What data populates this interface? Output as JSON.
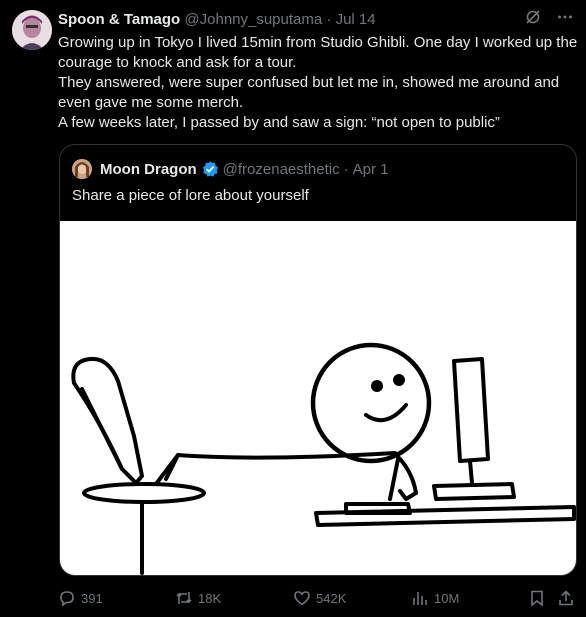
{
  "tweet": {
    "author_name": "Spoon & Tamago",
    "handle": "@Johnny_suputama",
    "separator": "·",
    "date": "Jul 14",
    "body": [
      "Growing up in Tokyo I lived 15min from Studio Ghibli. One day I worked up the courage to knock and ask for a tour.",
      "They answered, were super confused but let me in, showed me around and even gave me some merch.",
      "A few weeks later, I passed by and saw a sign: “not open to public”"
    ],
    "header_icons": [
      "grok-icon",
      "more-icon"
    ]
  },
  "quote": {
    "author_name": "Moon Dragon",
    "handle": "@frozenaesthetic",
    "separator": "·",
    "date": "Apr 1",
    "text": "Share a piece of lore about yourself",
    "media_description_icon": "stick-figure-at-computer-drawing"
  },
  "actions": {
    "replies": "391",
    "reposts": "18K",
    "likes": "542K",
    "views": "10M",
    "icons": [
      "reply-icon",
      "repost-icon",
      "like-icon",
      "views-icon",
      "bookmark-icon",
      "share-icon"
    ]
  },
  "colors": {
    "background": "#000000",
    "text": "#e7e9ea",
    "muted": "#71767b",
    "border": "#2f3336",
    "verified": "#1d9bf0"
  }
}
